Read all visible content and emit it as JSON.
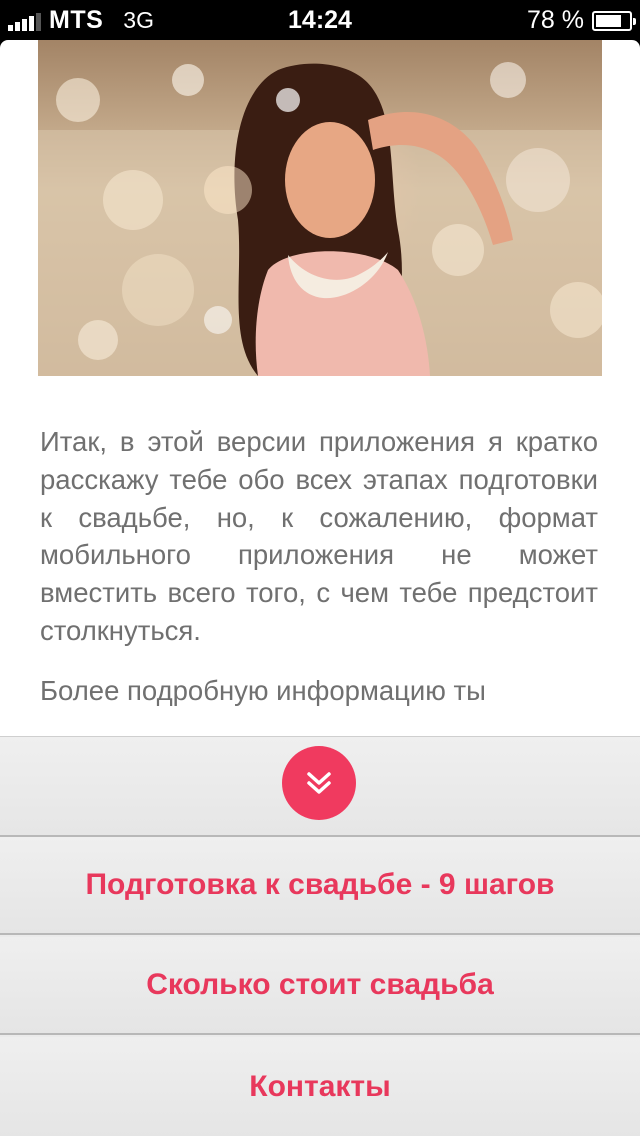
{
  "status_bar": {
    "carrier": "MTS",
    "network": "3G",
    "time": "14:24",
    "battery_percent_label": "78 %",
    "battery_level": 0.78,
    "signal_bars": 4
  },
  "article": {
    "paragraphs": [
      "Итак, в этой версии приложения я кратко расскажу тебе обо всех этапах подготовки к свадьбе, но, к сожалению, формат мобильного приложения не может вместить всего того, с чем тебе предстоит столкнуться.",
      "Более подробную информацию ты"
    ]
  },
  "menu": {
    "collapse_icon": "double-chevron-down-icon",
    "items": [
      {
        "label": "Подготовка к свадьбе - 9 шагов"
      },
      {
        "label": "Сколько стоит свадьба"
      },
      {
        "label": "Контакты"
      }
    ]
  },
  "colors": {
    "accent": "#f03a5f",
    "menu_text": "#e8385c",
    "body_text": "#707070",
    "menu_bg": "#ebebeb"
  }
}
